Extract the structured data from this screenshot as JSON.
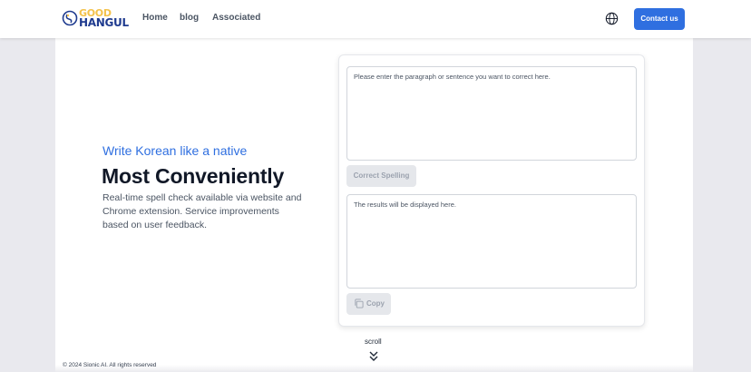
{
  "header": {
    "logo_line1": "GOOD",
    "logo_line2": "HANGUL",
    "nav": [
      "Home",
      "blog",
      "Associated"
    ],
    "language_icon": "globe-icon",
    "contact_label": "Contact us"
  },
  "hero": {
    "tagline": "Write Korean like a native",
    "headline": "Most Conveniently",
    "description": "Real-time spell check available via website and Chrome extension. Service improvements based on user feedback."
  },
  "editor": {
    "input_placeholder": "Please enter the paragraph or sentence you want to correct here.",
    "correct_label": "Correct Spelling",
    "output_text": "The results will be displayed here.",
    "copy_label": "Copy"
  },
  "scroll_label": "scroll",
  "footer_text": "© 2024 Sionic AI. All rights reserved",
  "colors": {
    "accent": "#2f6fe0",
    "logo_yellow": "#f3c24b",
    "logo_navy": "#1f3b8f"
  }
}
